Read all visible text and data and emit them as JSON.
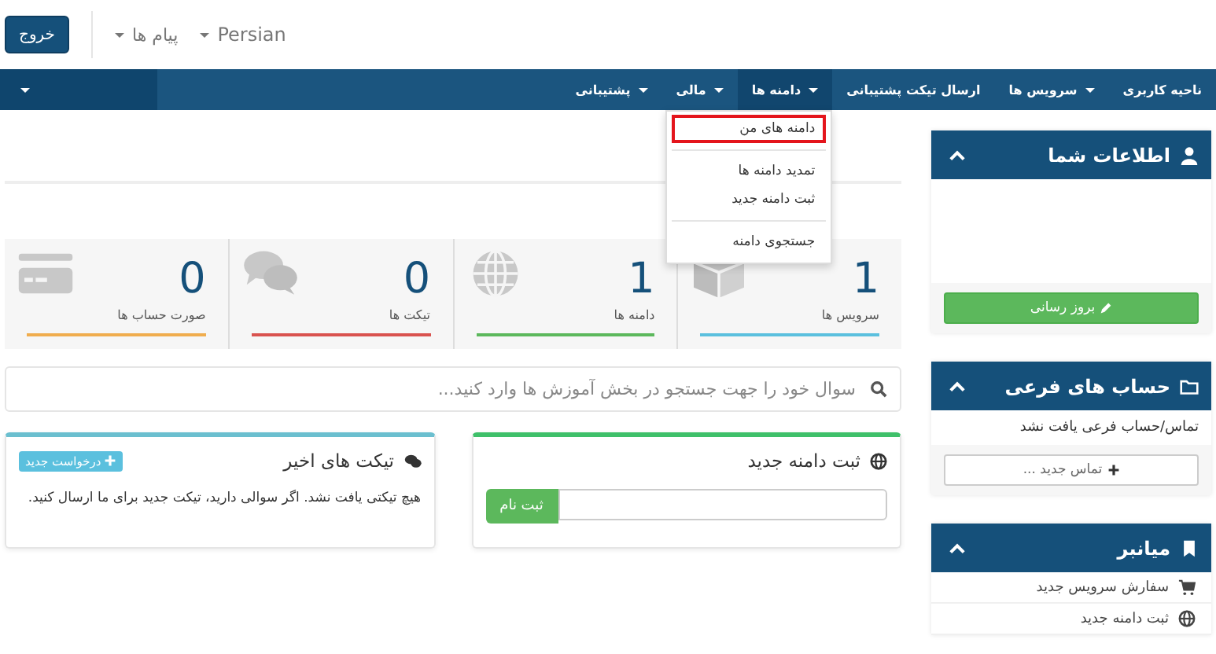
{
  "topbar": {
    "logout": "خروج",
    "messages": "پیام ها",
    "language": "Persian"
  },
  "nav": {
    "items": [
      {
        "label": "ناحیه کاربری",
        "caret": false,
        "selected": false
      },
      {
        "label": "سرویس ها",
        "caret": true,
        "selected": false
      },
      {
        "label": "ارسال تیکت پشتیبانی",
        "caret": false,
        "selected": false
      },
      {
        "label": "دامنه ها",
        "caret": true,
        "selected": true
      },
      {
        "label": "مالی",
        "caret": true,
        "selected": false
      },
      {
        "label": "پشتیبانی",
        "caret": true,
        "selected": false
      }
    ],
    "dropdown": [
      {
        "label": "دامنه های من",
        "selected": true,
        "divider_after": true
      },
      {
        "label": "تمدید دامنه ها",
        "selected": false,
        "divider_after": false
      },
      {
        "label": "ثبت دامنه جدید",
        "selected": false,
        "divider_after": true
      },
      {
        "label": "جستجوی دامنه",
        "selected": false,
        "divider_after": false
      }
    ]
  },
  "stats": [
    {
      "kind": "box",
      "value": "1",
      "label": "سرویس ها",
      "color": "#5bc0de"
    },
    {
      "kind": "globe",
      "value": "1",
      "label": "دامنه ها",
      "color": "#5cb85c"
    },
    {
      "kind": "chat",
      "value": "0",
      "label": "تیکت ها",
      "color": "#d9534f"
    },
    {
      "kind": "card",
      "value": "0",
      "label": "صورت حساب ها",
      "color": "#f0ad4e"
    }
  ],
  "search": {
    "placeholder": "سوال خود را جهت جستجو در بخش آموزش ها وارد کنید..."
  },
  "domain_panel": {
    "title": "ثبت دامنه جدید",
    "button": "ثبت نام"
  },
  "tickets_panel": {
    "title": "تیکت های اخیر",
    "button": "درخواست جدید",
    "message": "هیچ تیکتی یافت نشد. اگر سوالی دارید، تیکت جدید برای ما ارسال کنید."
  },
  "sidebar": [
    {
      "kind": "info",
      "title": "اطلاعات شما",
      "button": "بروز رسانی"
    },
    {
      "kind": "contacts",
      "title": "حساب های فرعی",
      "text": "تماس/حساب فرعی یافت نشد",
      "button": "تماس جدید ..."
    },
    {
      "kind": "shortcuts",
      "title": "میانبر",
      "links": [
        {
          "kind": "cart",
          "label": "سفارش سرویس جدید"
        },
        {
          "kind": "globe",
          "label": "ثبت دامنه جدید"
        }
      ]
    }
  ]
}
